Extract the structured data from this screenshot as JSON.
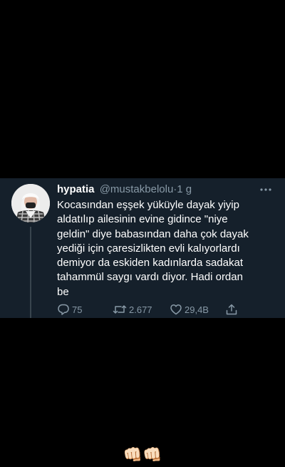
{
  "tweet": {
    "display_name": "hypatia",
    "handle": "@mustakbelolu",
    "separator": "·",
    "time": "1 g",
    "text": "Kocasından eşşek yüküyle dayak yiyip\naldatılıp ailesinin evine gidince \"niye\ngeldin\" diye babasından daha çok dayak\nyediği için çaresizlikten evli kalıyorlardı\ndemiyor da eskiden kadınlarda sadakat\ntahammül saygı vardı diyor. Hadi ordan\nbe",
    "actions": {
      "reply_count": "75",
      "retweet_count": "2.677",
      "like_count": "29,4B"
    },
    "icons": [
      "more-icon",
      "reply-icon",
      "retweet-icon",
      "like-icon",
      "share-icon"
    ]
  },
  "caption_emoji": "👊🏻👊🏻",
  "colors": {
    "background": "#000000",
    "card": "#15202b",
    "primary_text": "#ffffff",
    "secondary_text": "#8899a6",
    "thread_line": "#38444d"
  }
}
